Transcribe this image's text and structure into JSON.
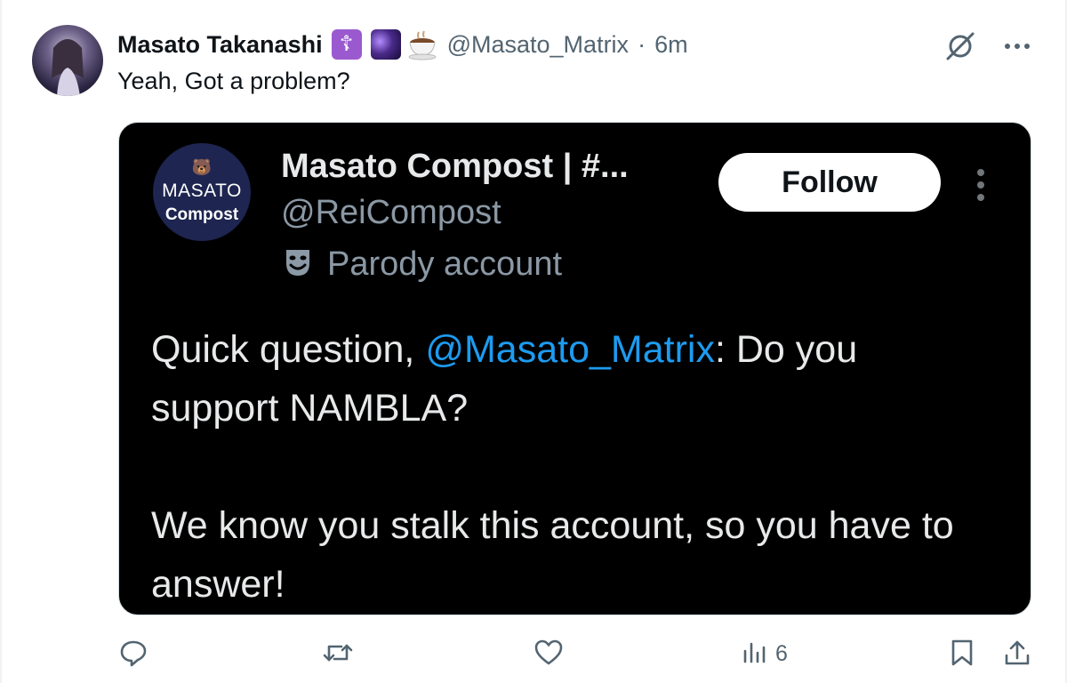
{
  "tweet": {
    "author": {
      "display_name": "Masato Takanashi",
      "emojis": [
        "orthodox-cross-emoji",
        "galaxy-emoji",
        "tea-cup-emoji"
      ],
      "handle": "@Masato_Matrix",
      "separator": "·",
      "time": "6m"
    },
    "text": "Yeah, Got a problem?",
    "quoted": {
      "avatar_line1": "MASATO",
      "avatar_line2": "Compost",
      "display_name": "Masato Compost | #...",
      "handle": "@ReiCompost",
      "badge_label": "Parody account",
      "follow_label": "Follow",
      "body_prefix": "Quick question, ",
      "mention": "@Masato_Matrix",
      "body_suffix": ": Do you support NAMBLA?",
      "body_paragraph2": "We know you stalk this account, so you have to answer!"
    },
    "actions": {
      "views_count": "6"
    }
  },
  "colors": {
    "link": "#1d9bf0",
    "secondary_text": "#536471",
    "card_background": "#000000",
    "card_text": "#e7e9ea"
  }
}
